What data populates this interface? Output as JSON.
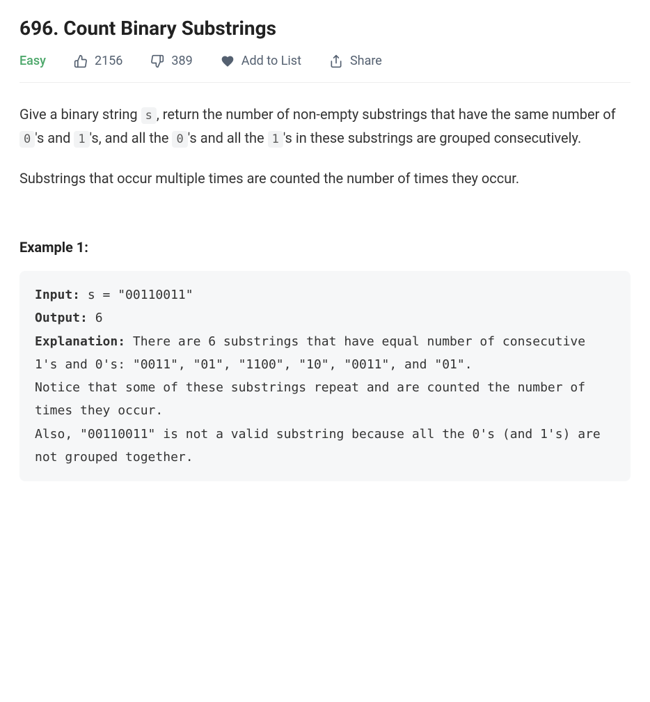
{
  "title": "696. Count Binary Substrings",
  "meta": {
    "difficulty": "Easy",
    "likes": "2156",
    "dislikes": "389",
    "add_to_list": "Add to List",
    "share": "Share"
  },
  "description": {
    "p1_a": "Give a binary string ",
    "p1_code_s": "s",
    "p1_b": ", return the number of non-empty substrings that have the same number of ",
    "p1_code_0a": "0",
    "p1_c": "'s and ",
    "p1_code_1a": "1",
    "p1_d": "'s, and all the ",
    "p1_code_0b": "0",
    "p1_e": "'s and all the ",
    "p1_code_1b": "1",
    "p1_f": "'s in these substrings are grouped consecutively.",
    "p2": "Substrings that occur multiple times are counted the number of times they occur."
  },
  "example": {
    "heading": "Example 1:",
    "input_label": "Input:",
    "input_value": " s = \"00110011\"",
    "output_label": "Output:",
    "output_value": " 6",
    "explanation_label": "Explanation:",
    "explanation_value": " There are 6 substrings that have equal number of consecutive 1's and 0's: \"0011\", \"01\", \"1100\", \"10\", \"0011\", and \"01\".\nNotice that some of these substrings repeat and are counted the number of times they occur.\nAlso, \"00110011\" is not a valid substring because all the 0's (and 1's) are not grouped together."
  }
}
